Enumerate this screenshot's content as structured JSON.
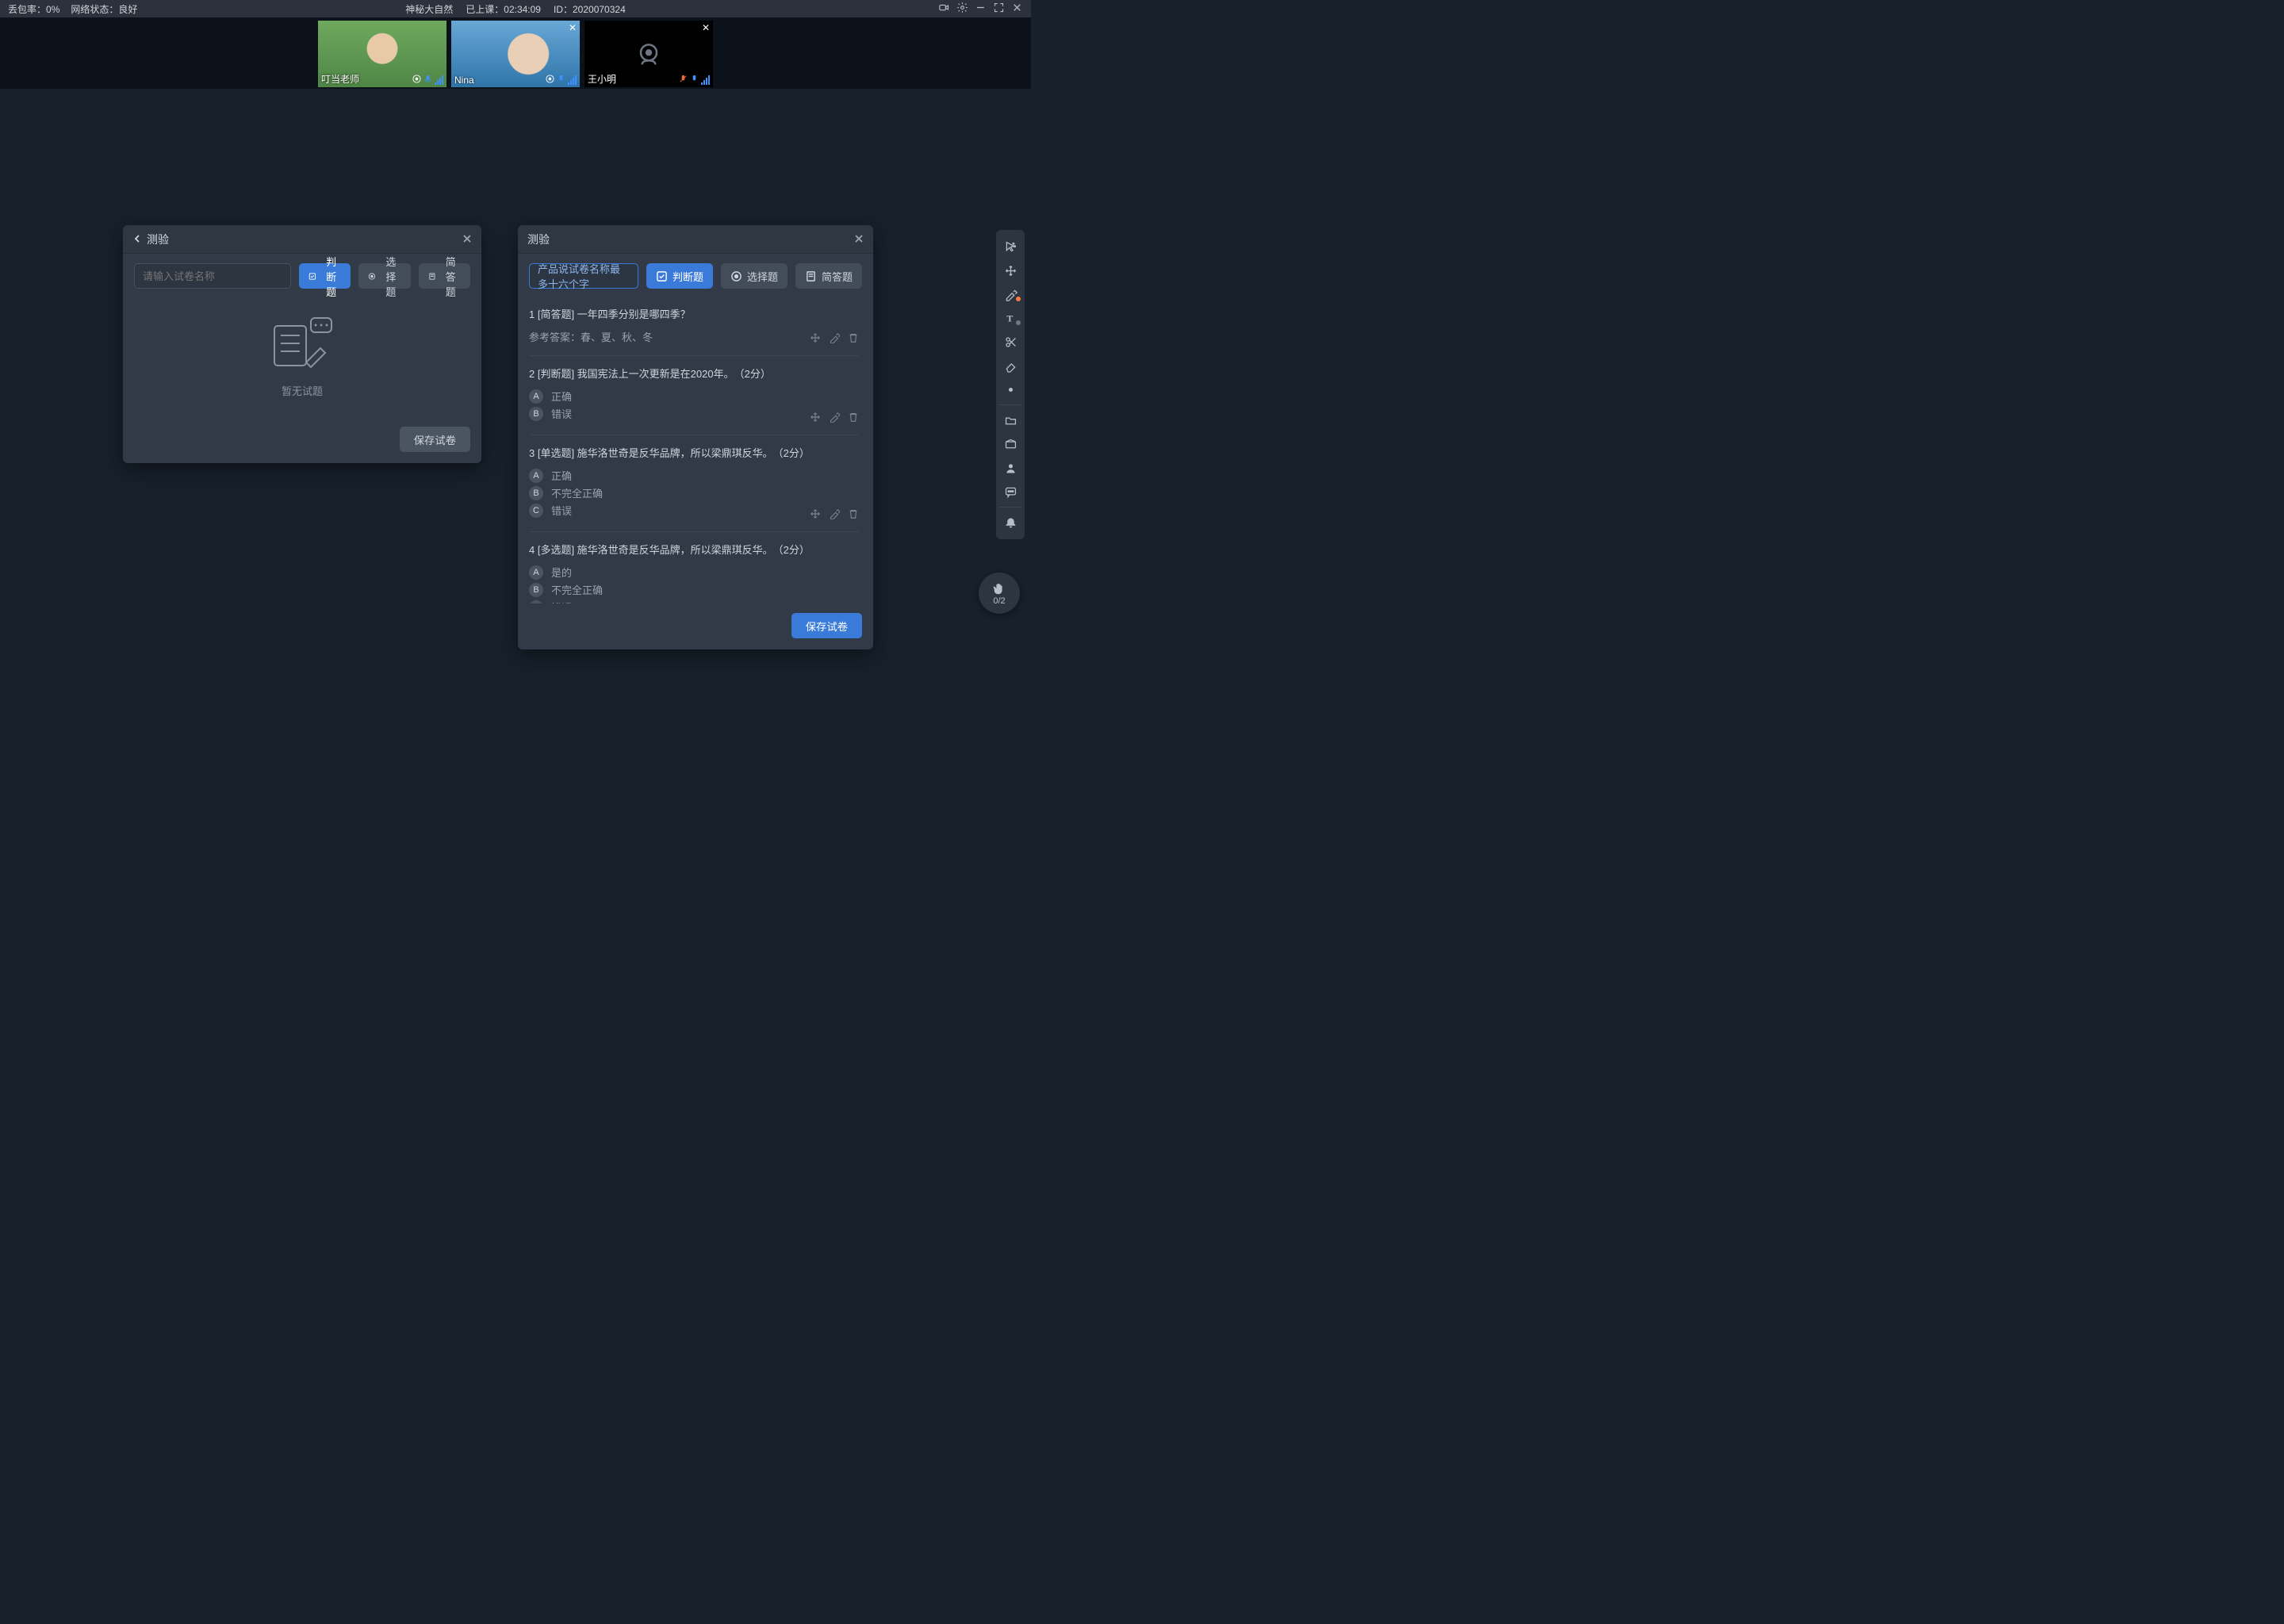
{
  "colors": {
    "accent": "#3a7bd9"
  },
  "topbar": {
    "loss_label": "丢包率：",
    "loss_value": "0%",
    "net_label": "网络状态：",
    "net_value": "良好",
    "course_title": "神秘大自然",
    "elapsed_label": "已上课：",
    "elapsed_value": "02:34:09",
    "id_label": "ID：",
    "id_value": "2020070324"
  },
  "videos": [
    {
      "name": "叮当老师",
      "camera_on": true,
      "closeable": false,
      "mic_on": true,
      "mic_color": "#3f8fff"
    },
    {
      "name": "Nina",
      "camera_on": true,
      "closeable": true,
      "mic_on": true,
      "mic_color": "#3f8fff"
    },
    {
      "name": "王小明",
      "camera_on": false,
      "closeable": true,
      "mic_on": true,
      "mic_muted": true,
      "mic_color": "#3f8fff"
    }
  ],
  "panel_left": {
    "title": "测验",
    "input_placeholder": "请输入试卷名称",
    "btn_judge": "判断题",
    "btn_choice": "选择题",
    "btn_essay": "简答题",
    "empty_text": "暂无试题",
    "save_label": "保存试卷"
  },
  "panel_right": {
    "title": "测验",
    "input_value": "产品说试卷名称最多十六个字",
    "btn_judge": "判断题",
    "btn_choice": "选择题",
    "btn_essay": "简答题",
    "save_label": "保存试卷",
    "questions": [
      {
        "index": "1",
        "type": "[简答题]",
        "text": "一年四季分别是哪四季？",
        "reference_label": "参考答案：",
        "reference": "春、夏、秋、冬",
        "options": []
      },
      {
        "index": "2",
        "type": "[判断题]",
        "text": "我国宪法上一次更新是在2020年。",
        "points": "（2分）",
        "options": [
          {
            "key": "A",
            "text": "正确"
          },
          {
            "key": "B",
            "text": "错误"
          }
        ]
      },
      {
        "index": "3",
        "type": "[单选题]",
        "text": "施华洛世奇是反华品牌，所以梁鼎琪反华。",
        "points": "（2分）",
        "options": [
          {
            "key": "A",
            "text": "正确"
          },
          {
            "key": "B",
            "text": "不完全正确"
          },
          {
            "key": "C",
            "text": "错误"
          }
        ]
      },
      {
        "index": "4",
        "type": "[多选题]",
        "text": "施华洛世奇是反华品牌，所以梁鼎琪反华。",
        "points": "（2分）",
        "options": [
          {
            "key": "A",
            "text": "是的"
          },
          {
            "key": "B",
            "text": "不完全正确"
          },
          {
            "key": "C",
            "text": "错误"
          }
        ]
      }
    ]
  },
  "toolbar": {
    "tools": [
      "cursor-select-icon",
      "move-icon",
      "pen-icon",
      "text-tool-icon",
      "scissors-icon",
      "eraser-icon",
      "brightness-icon",
      "folder-icon",
      "assets-icon",
      "person-icon",
      "chat-icon",
      "bell-icon"
    ]
  },
  "hand_raise": {
    "count": "0/2"
  }
}
